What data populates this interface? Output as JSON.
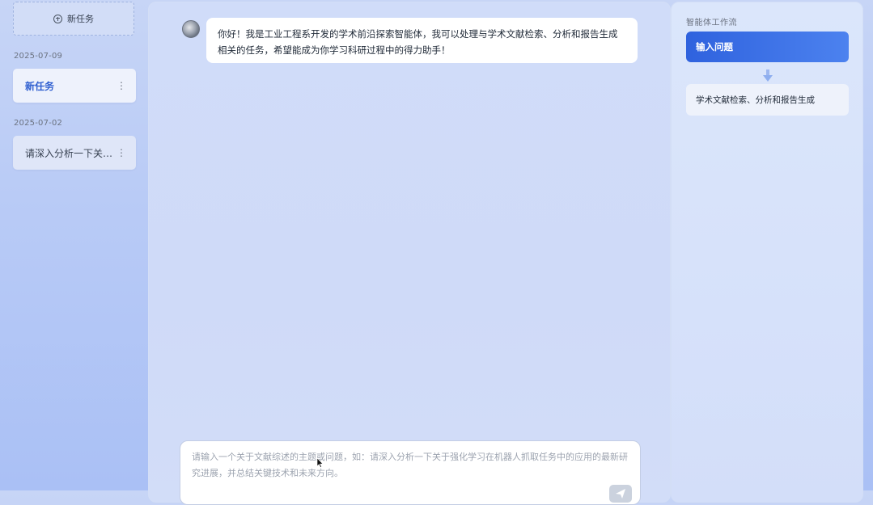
{
  "sidebar": {
    "new_task_label": "新任务",
    "groups": [
      {
        "date": "2025-07-09",
        "tasks": [
          {
            "title": "新任务",
            "active": true
          }
        ]
      },
      {
        "date": "2025-07-02",
        "tasks": [
          {
            "title": "请深入分析一下关…",
            "active": false
          }
        ]
      }
    ]
  },
  "chat": {
    "messages": [
      {
        "role": "assistant",
        "text": "你好！我是工业工程系开发的学术前沿探索智能体，我可以处理与学术文献检索、分析和报告生成相关的任务，希望能成为你学习科研过程中的得力助手！"
      }
    ],
    "input": {
      "value": "",
      "placeholder": "请输入一个关于文献综述的主题或问题，如：请深入分析一下关于强化学习在机器人抓取任务中的应用的最新研究进展，并总结关键技术和未来方向。"
    },
    "send_icon": "send-icon"
  },
  "workflow": {
    "title": "智能体工作流",
    "steps": [
      {
        "label": "输入问题",
        "active": true
      },
      {
        "label": "学术文献检索、分析和报告生成",
        "active": false
      }
    ]
  },
  "colors": {
    "accent": "#2f62de",
    "active_task_text": "#2f5fd0",
    "background": "#bccdf6"
  }
}
